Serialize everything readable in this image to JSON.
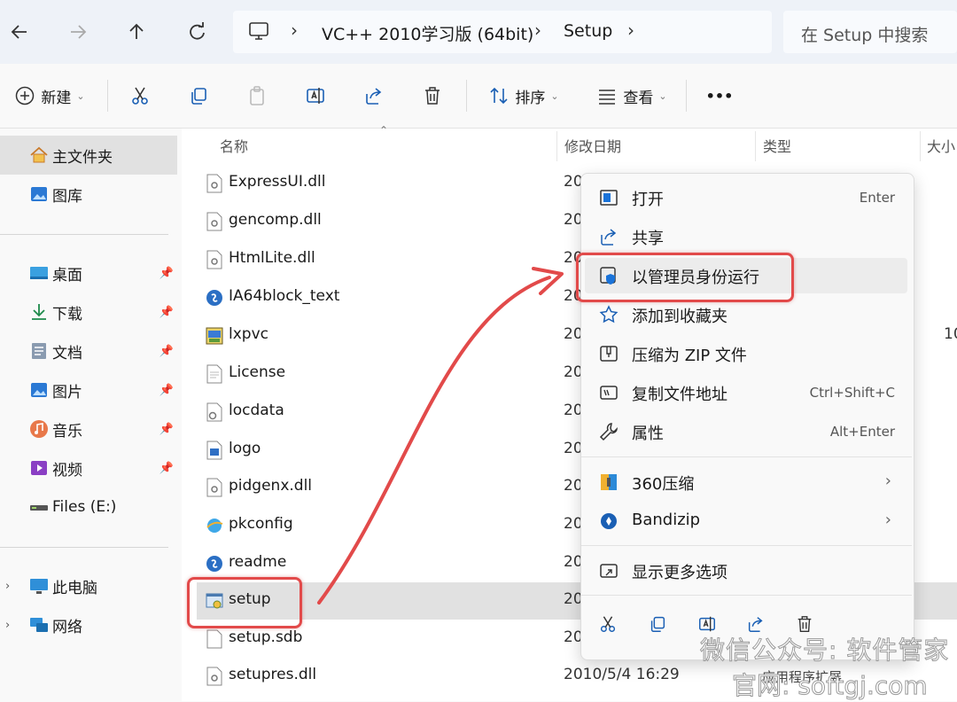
{
  "addressbar": {
    "breadcrumbs": [
      "VC++ 2010学习版 (64bit)",
      "Setup"
    ],
    "search_placeholder": "在 Setup 中搜索"
  },
  "toolbar": {
    "new_label": "新建",
    "sort_label": "排序",
    "view_label": "查看",
    "more_label": "•••"
  },
  "sidebar": {
    "items": [
      {
        "label": "主文件夹",
        "icon": "home-icon"
      },
      {
        "label": "图库",
        "icon": "gallery-icon"
      },
      {
        "label": "桌面",
        "icon": "desktop-icon",
        "pinned": true
      },
      {
        "label": "下载",
        "icon": "download-icon",
        "pinned": true
      },
      {
        "label": "文档",
        "icon": "documents-icon",
        "pinned": true
      },
      {
        "label": "图片",
        "icon": "pictures-icon",
        "pinned": true
      },
      {
        "label": "音乐",
        "icon": "music-icon",
        "pinned": true
      },
      {
        "label": "视频",
        "icon": "videos-icon",
        "pinned": true
      },
      {
        "label": "Files (E:)",
        "icon": "drive-icon"
      },
      {
        "label": "此电脑",
        "icon": "this-pc-icon"
      },
      {
        "label": "网络",
        "icon": "network-icon"
      }
    ]
  },
  "filelist": {
    "columns": [
      "名称",
      "修改日期",
      "类型",
      "大小"
    ],
    "files": [
      {
        "name": "ExpressUI.dll",
        "date": "20",
        "icon": "dll-file-icon"
      },
      {
        "name": "gencomp.dll",
        "date": "20",
        "icon": "dll-file-icon"
      },
      {
        "name": "HtmlLite.dll",
        "date": "20",
        "icon": "dll-file-icon"
      },
      {
        "name": "IA64block_text",
        "date": "20",
        "icon": "text-doc-icon"
      },
      {
        "name": "lxpvc",
        "date": "20",
        "icon": "app-icon"
      },
      {
        "name": "License",
        "date": "20",
        "icon": "file-icon"
      },
      {
        "name": "locdata",
        "date": "20",
        "icon": "settings-file-icon"
      },
      {
        "name": "logo",
        "date": "20",
        "icon": "image-file-icon"
      },
      {
        "name": "pidgenx.dll",
        "date": "20",
        "icon": "dll-file-icon"
      },
      {
        "name": "pkconfig",
        "date": "20",
        "icon": "web-file-icon"
      },
      {
        "name": "readme",
        "date": "20",
        "icon": "text-doc-icon"
      },
      {
        "name": "setup",
        "date": "20",
        "icon": "setup-exe-icon"
      },
      {
        "name": "setup.sdb",
        "date": "20",
        "icon": "file-icon"
      },
      {
        "name": "setupres.dll",
        "date": "2010/5/4 16:29",
        "icon": "dll-file-icon"
      }
    ],
    "size_fragment": "10"
  },
  "context_menu": {
    "items": [
      {
        "label": "打开",
        "shortcut": "Enter",
        "icon": "open-icon"
      },
      {
        "label": "共享",
        "shortcut": "",
        "icon": "share-icon"
      },
      {
        "label": "以管理员身份运行",
        "shortcut": "",
        "icon": "shield-icon"
      },
      {
        "label": "添加到收藏夹",
        "shortcut": "",
        "icon": "star-icon"
      },
      {
        "label": "压缩为 ZIP 文件",
        "shortcut": "",
        "icon": "zip-icon"
      },
      {
        "label": "复制文件地址",
        "shortcut": "Ctrl+Shift+C",
        "icon": "copy-path-icon"
      },
      {
        "label": "属性",
        "shortcut": "Alt+Enter",
        "icon": "properties-icon"
      },
      {
        "label": "360压缩",
        "shortcut": "",
        "icon": "archive-360-icon"
      },
      {
        "label": "Bandizip",
        "shortcut": "",
        "icon": "bandizip-icon"
      },
      {
        "label": "显示更多选项",
        "shortcut": "",
        "icon": "more-options-icon"
      }
    ],
    "app_extension_label": "应用程序扩展"
  },
  "watermark": {
    "line1": "微信公众号: 软件管家",
    "line2": "官网: softgj.com"
  },
  "colors": {
    "accent": "#0067c0",
    "annotation_red": "#e24a4a",
    "selection": "#e1e1e1"
  }
}
